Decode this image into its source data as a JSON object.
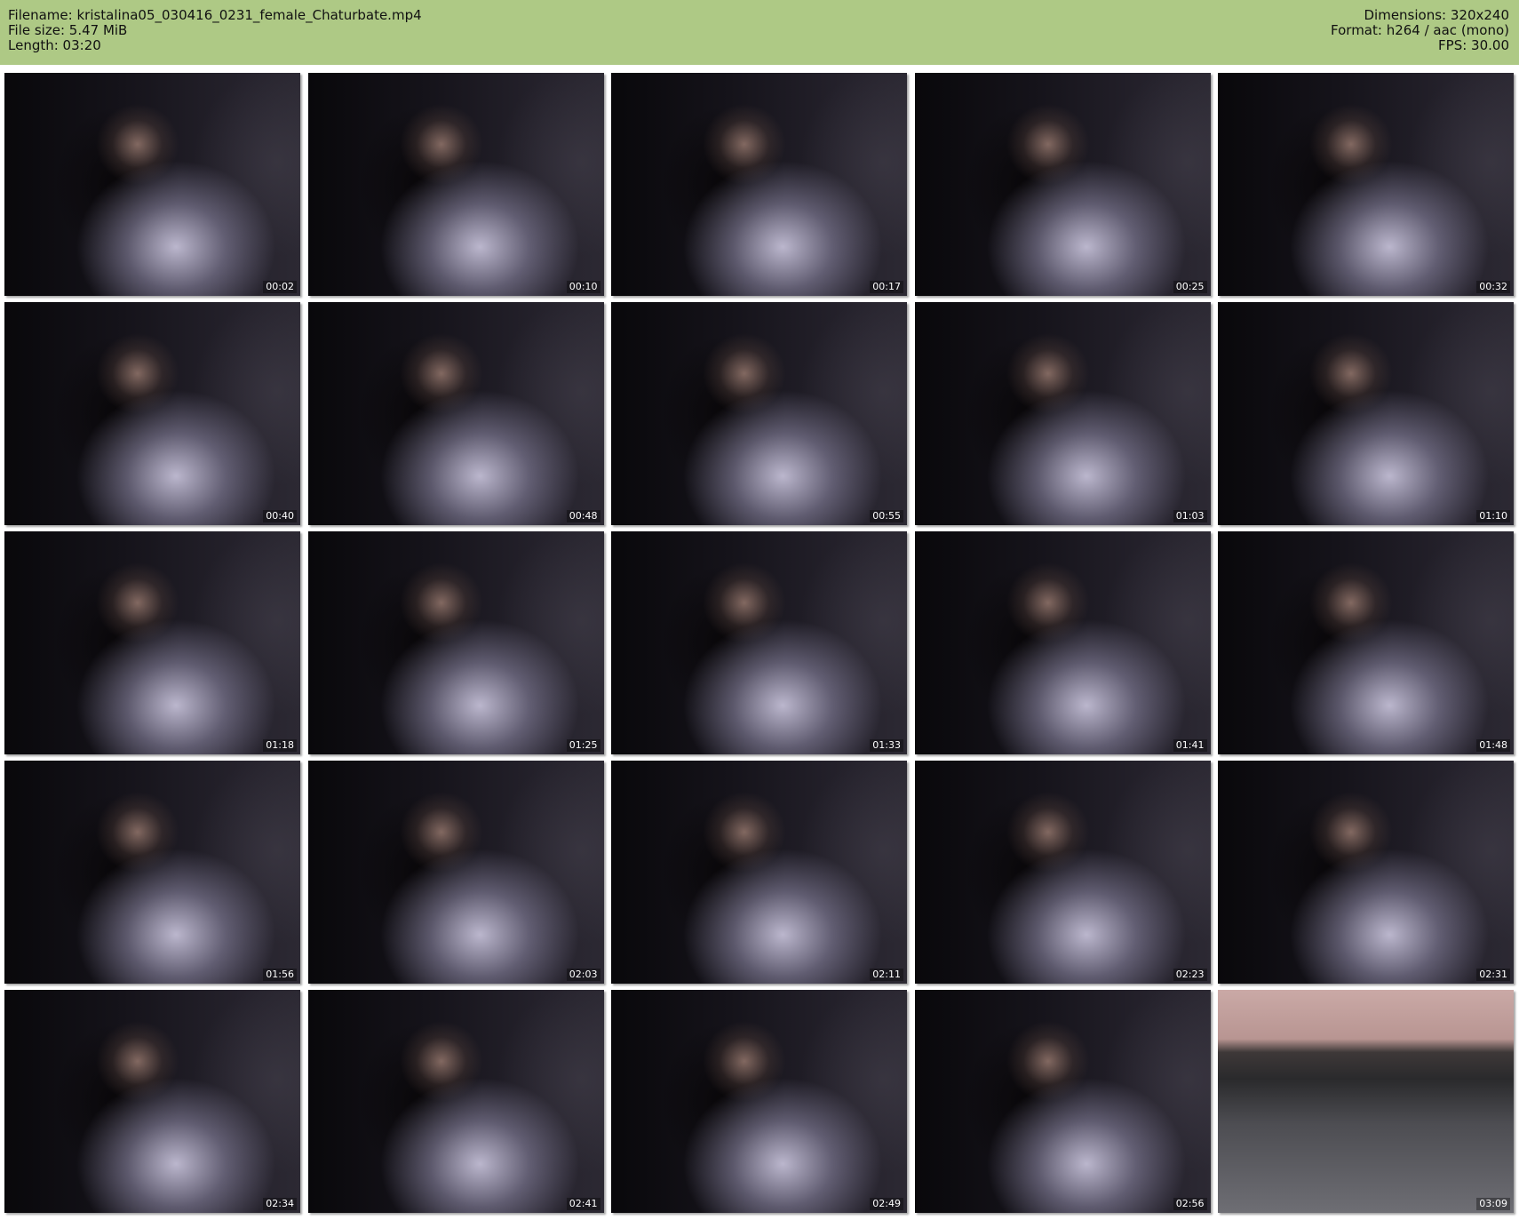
{
  "header": {
    "filename": "Filename: kristalina05_030416_0231_female_Chaturbate.mp4",
    "file_size": "File size: 5.47 MiB",
    "length": "Length: 03:20",
    "dimensions": "Dimensions: 320x240",
    "format": "Format: h264 / aac (mono)",
    "fps": "FPS: 30.00"
  },
  "colors": {
    "header_background": "#aec985",
    "timestamp_text": "#ffffff"
  },
  "thumbnails": [
    {
      "timestamp": "00:02"
    },
    {
      "timestamp": "00:10"
    },
    {
      "timestamp": "00:17"
    },
    {
      "timestamp": "00:25"
    },
    {
      "timestamp": "00:32"
    },
    {
      "timestamp": "00:40"
    },
    {
      "timestamp": "00:48"
    },
    {
      "timestamp": "00:55"
    },
    {
      "timestamp": "01:03"
    },
    {
      "timestamp": "01:10"
    },
    {
      "timestamp": "01:18"
    },
    {
      "timestamp": "01:25"
    },
    {
      "timestamp": "01:33"
    },
    {
      "timestamp": "01:41"
    },
    {
      "timestamp": "01:48"
    },
    {
      "timestamp": "01:56"
    },
    {
      "timestamp": "02:03"
    },
    {
      "timestamp": "02:11"
    },
    {
      "timestamp": "02:23"
    },
    {
      "timestamp": "02:31"
    },
    {
      "timestamp": "02:34"
    },
    {
      "timestamp": "02:41"
    },
    {
      "timestamp": "02:49"
    },
    {
      "timestamp": "02:56"
    },
    {
      "timestamp": "03:09"
    }
  ]
}
